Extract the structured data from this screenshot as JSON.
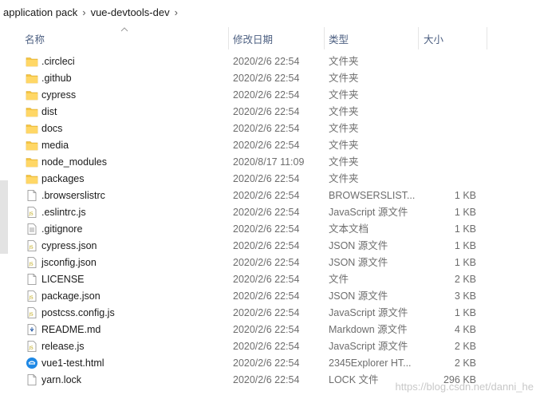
{
  "breadcrumb": {
    "items": [
      "application pack",
      "vue-devtools-dev"
    ],
    "separator": "›"
  },
  "columns": {
    "name": "名称",
    "date": "修改日期",
    "type": "类型",
    "size": "大小"
  },
  "files": [
    {
      "name": ".circleci",
      "date": "2020/2/6 22:54",
      "type": "文件夹",
      "size": "",
      "icon": "folder-icon"
    },
    {
      "name": ".github",
      "date": "2020/2/6 22:54",
      "type": "文件夹",
      "size": "",
      "icon": "folder-icon"
    },
    {
      "name": "cypress",
      "date": "2020/2/6 22:54",
      "type": "文件夹",
      "size": "",
      "icon": "folder-icon"
    },
    {
      "name": "dist",
      "date": "2020/2/6 22:54",
      "type": "文件夹",
      "size": "",
      "icon": "folder-icon"
    },
    {
      "name": "docs",
      "date": "2020/2/6 22:54",
      "type": "文件夹",
      "size": "",
      "icon": "folder-icon"
    },
    {
      "name": "media",
      "date": "2020/2/6 22:54",
      "type": "文件夹",
      "size": "",
      "icon": "folder-icon"
    },
    {
      "name": "node_modules",
      "date": "2020/8/17 11:09",
      "type": "文件夹",
      "size": "",
      "icon": "folder-icon"
    },
    {
      "name": "packages",
      "date": "2020/2/6 22:54",
      "type": "文件夹",
      "size": "",
      "icon": "folder-icon"
    },
    {
      "name": ".browserslistrc",
      "date": "2020/2/6 22:54",
      "type": "BROWSERSLIST...",
      "size": "1 KB",
      "icon": "file-icon"
    },
    {
      "name": ".eslintrc.js",
      "date": "2020/2/6 22:54",
      "type": "JavaScript 源文件",
      "size": "1 KB",
      "icon": "js-file-icon"
    },
    {
      "name": ".gitignore",
      "date": "2020/2/6 22:54",
      "type": "文本文档",
      "size": "1 KB",
      "icon": "text-file-icon"
    },
    {
      "name": "cypress.json",
      "date": "2020/2/6 22:54",
      "type": "JSON 源文件",
      "size": "1 KB",
      "icon": "js-file-icon"
    },
    {
      "name": "jsconfig.json",
      "date": "2020/2/6 22:54",
      "type": "JSON 源文件",
      "size": "1 KB",
      "icon": "js-file-icon"
    },
    {
      "name": "LICENSE",
      "date": "2020/2/6 22:54",
      "type": "文件",
      "size": "2 KB",
      "icon": "file-icon"
    },
    {
      "name": "package.json",
      "date": "2020/2/6 22:54",
      "type": "JSON 源文件",
      "size": "3 KB",
      "icon": "js-file-icon"
    },
    {
      "name": "postcss.config.js",
      "date": "2020/2/6 22:54",
      "type": "JavaScript 源文件",
      "size": "1 KB",
      "icon": "js-file-icon"
    },
    {
      "name": "README.md",
      "date": "2020/2/6 22:54",
      "type": "Markdown 源文件",
      "size": "4 KB",
      "icon": "markdown-file-icon"
    },
    {
      "name": "release.js",
      "date": "2020/2/6 22:54",
      "type": "JavaScript 源文件",
      "size": "2 KB",
      "icon": "js-file-icon"
    },
    {
      "name": "vue1-test.html",
      "date": "2020/2/6 22:54",
      "type": "2345Explorer HT...",
      "size": "2 KB",
      "icon": "browser-html-icon"
    },
    {
      "name": "yarn.lock",
      "date": "2020/2/6 22:54",
      "type": "LOCK 文件",
      "size": "296 KB",
      "icon": "file-icon"
    }
  ],
  "watermark": "https://blog.csdn.net/danni_he",
  "colors": {
    "folder": "#f5c542",
    "header_text": "#4d6082",
    "secondary_text": "#6d6d6d",
    "html_icon": "#1e88e5"
  }
}
